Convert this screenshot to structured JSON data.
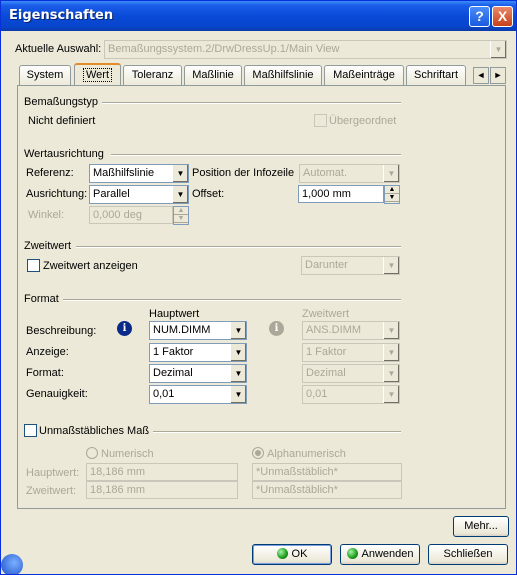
{
  "window": {
    "title": "Eigenschaften"
  },
  "titlebar": {
    "help": "?",
    "close": "X"
  },
  "selection": {
    "label": "Aktuelle Auswahl:",
    "value": "Bemaßungssystem.2/DrwDressUp.1/Main View"
  },
  "tabs": [
    {
      "label": "System"
    },
    {
      "label": "Wert"
    },
    {
      "label": "Toleranz"
    },
    {
      "label": "Maßlinie"
    },
    {
      "label": "Maßhilfslinie"
    },
    {
      "label": "Maßeinträge"
    },
    {
      "label": "Schriftart"
    }
  ],
  "tab_scroll": {
    "left": "◄",
    "right": "►"
  },
  "bemassungstyp": {
    "title": "Bemaßungstyp",
    "value": "Nicht definiert",
    "uebergeordnet": "Übergeordnet"
  },
  "wertausrichtung": {
    "title": "Wertausrichtung",
    "referenz_label": "Referenz:",
    "referenz_value": "Maßhilfslinie",
    "position_label": "Position der Infozeile",
    "position_value": "Automat.",
    "ausrichtung_label": "Ausrichtung:",
    "ausrichtung_value": "Parallel",
    "offset_label": "Offset:",
    "offset_value": "1,000 mm",
    "winkel_label": "Winkel:",
    "winkel_value": "0,000 deg"
  },
  "zweitwert": {
    "title": "Zweitwert",
    "checkbox_label": "Zweitwert anzeigen",
    "position_value": "Darunter"
  },
  "format": {
    "title": "Format",
    "hauptwert_header": "Hauptwert",
    "zweitwert_header": "Zweitwert",
    "beschreibung_label": "Beschreibung:",
    "anzeige_label": "Anzeige:",
    "format_label": "Format:",
    "genauigkeit_label": "Genauigkeit:",
    "haupt": {
      "beschreibung": "NUM.DIMM",
      "anzeige": "1 Faktor",
      "format": "Dezimal",
      "genauigkeit": "0,01"
    },
    "zweit": {
      "beschreibung": "ANS.DIMM",
      "anzeige": "1 Faktor",
      "format": "Dezimal",
      "genauigkeit": "0,01"
    },
    "info_glyph": "i"
  },
  "unmassstaeblich": {
    "checkbox_label": "Unmaßstäbliches Maß",
    "numerisch": "Numerisch",
    "alphanumerisch": "Alphanumerisch",
    "hauptwert_label": "Hauptwert:",
    "zweitwert_label": "Zweitwert:",
    "hauptwert_num": "18,186 mm",
    "zweitwert_num": "18,186 mm",
    "hauptwert_alpha": "*Unmaßstäblich*",
    "zweitwert_alpha": "*Unmaßstäblich*"
  },
  "buttons": {
    "mehr": "Mehr...",
    "ok": "OK",
    "anwenden": "Anwenden",
    "schliessen": "Schließen"
  },
  "icons": {
    "combo_arrow": "▼",
    "spin_up": "▲",
    "spin_down": "▼",
    "accent_color": "#e68b2c"
  }
}
